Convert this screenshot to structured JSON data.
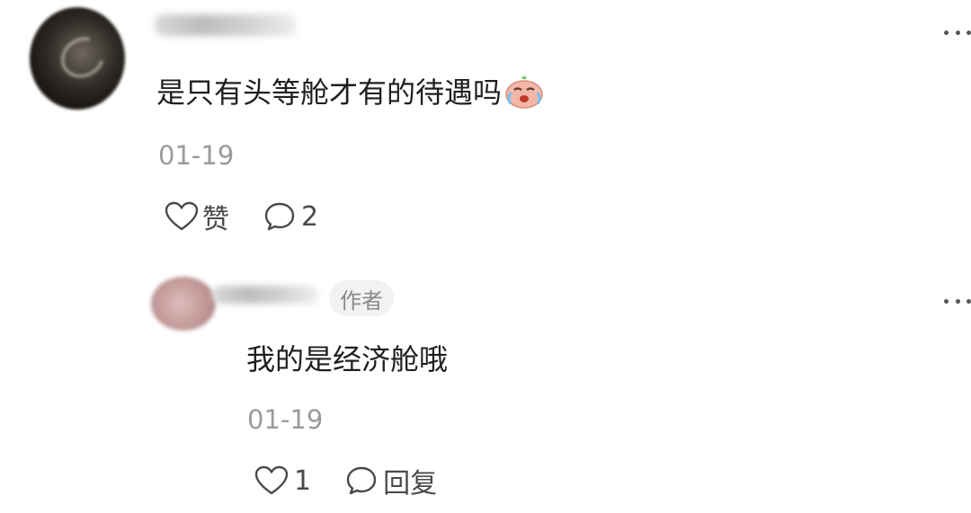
{
  "comment": {
    "text": "是只有头等舱才有的待遇吗",
    "emoji_icon": "crying-face-emoji",
    "date": "01-19",
    "like_label": "赞",
    "reply_count": "2"
  },
  "reply": {
    "author_tag": "作者",
    "text": "我的是经济舱哦",
    "date": "01-19",
    "like_count": "1",
    "reply_label": "回复"
  },
  "icons": {
    "like": "heart-outline-icon",
    "comment": "speech-bubble-icon",
    "more": "more-dots-icon"
  }
}
